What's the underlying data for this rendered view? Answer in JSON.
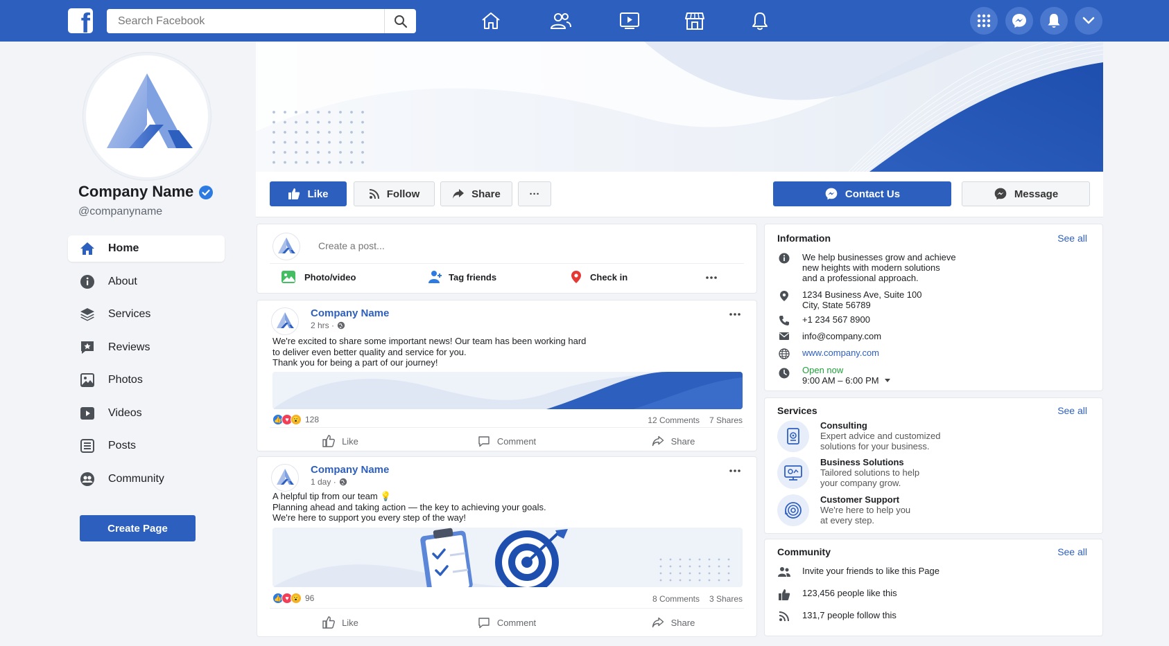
{
  "colors": {
    "brand": "#2d5fbf",
    "page_bg": "#f2f4f8",
    "open_green": "#1fa33a",
    "pin_red": "#e53935"
  },
  "topbar": {
    "logo_letter": "f",
    "search_placeholder": "Search Facebook",
    "nav_icons": [
      "home-icon",
      "friends-icon",
      "watch-icon",
      "marketplace-icon",
      "notifications-bell-icon"
    ],
    "right_icons": [
      "menu-grid-icon",
      "messenger-icon",
      "notification-icon",
      "account-chevron-icon"
    ]
  },
  "profile": {
    "name": "Company Name",
    "handle": "@companyname"
  },
  "sidebar": {
    "items": [
      {
        "label": "Home",
        "icon": "home-icon",
        "active": true
      },
      {
        "label": "About",
        "icon": "info-icon"
      },
      {
        "label": "Services",
        "icon": "layers-icon"
      },
      {
        "label": "Reviews",
        "icon": "star-comment-icon"
      },
      {
        "label": "Photos",
        "icon": "image-icon"
      },
      {
        "label": "Videos",
        "icon": "video-icon"
      },
      {
        "label": "Posts",
        "icon": "posts-icon"
      },
      {
        "label": "Community",
        "icon": "group-icon"
      }
    ],
    "create_page_label": "Create Page"
  },
  "actions": {
    "like": "Like",
    "follow": "Follow",
    "share": "Share",
    "more": "···",
    "contact": "Contact Us",
    "message": "Message"
  },
  "composer": {
    "placeholder": "Create a post...",
    "photo": "Photo/video",
    "tag": "Tag friends",
    "checkin": "Check in"
  },
  "posts": [
    {
      "author": "Company Name",
      "meta": "2 hrs ·",
      "lines": [
        "We're excited to share some important news! Our team has been working hard",
        "to deliver even better quality and service for you.",
        "Thank you for being a part of our journey!"
      ],
      "reactions": "128",
      "comments": "12 Comments",
      "shares": "7 Shares",
      "like": "Like",
      "comment": "Comment",
      "share": "Share"
    },
    {
      "author": "Company Name",
      "meta": "1 day ·",
      "lines": [
        "A helpful tip from our team 💡",
        "Planning ahead and taking action — the key to achieving your goals.",
        "We're here to support you every step of the way!"
      ],
      "reactions": "96",
      "comments": "8 Comments",
      "shares": "3 Shares",
      "like": "Like",
      "comment": "Comment",
      "share": "Share"
    }
  ],
  "information": {
    "title": "Information",
    "see_all": "See all",
    "about_lines": [
      "We help businesses grow and achieve",
      "new heights with modern solutions",
      "and a professional approach."
    ],
    "address_lines": [
      "1234 Business Ave, Suite 100",
      "City, State 56789"
    ],
    "phone": "+1 234 567 8900",
    "email": "info@company.com",
    "website": "www.company.com",
    "open_status": "Open now",
    "hours": "9:00 AM – 6:00 PM"
  },
  "services": {
    "title": "Services",
    "see_all": "See all",
    "items": [
      {
        "name": "Consulting",
        "desc": [
          "Expert advice and customized",
          "solutions for your business."
        ]
      },
      {
        "name": "Business Solutions",
        "desc": [
          "Tailored solutions to help",
          "your company grow."
        ]
      },
      {
        "name": "Customer Support",
        "desc": [
          "We're here to help you",
          "at every step."
        ]
      }
    ]
  },
  "community": {
    "title": "Community",
    "see_all": "See all",
    "invite": "Invite your friends to like this Page",
    "likes": "123,456 people like this",
    "follows": "131,7 people follow this"
  }
}
